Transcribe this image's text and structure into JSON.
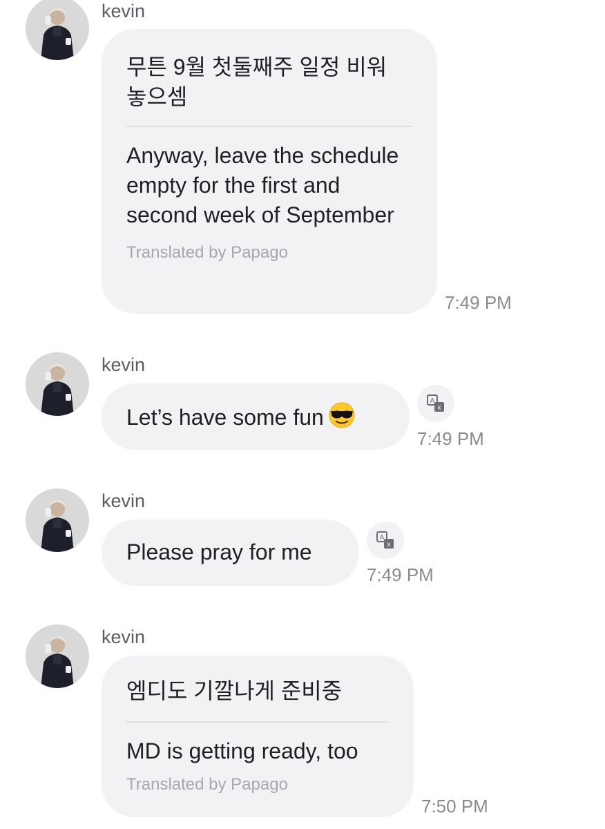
{
  "messages": [
    {
      "sender": "kevin",
      "original": "무튼 9월 첫둘째주 일정 비워 놓으셈",
      "translated": "Anyway, leave the schedule empty for the first and second week of September",
      "credit": "Translated by Papago",
      "time": "7:49 PM"
    },
    {
      "sender": "kevin",
      "text": "Let’s have some fun",
      "emoji": "smiling-face-with-sunglasses",
      "time": "7:49 PM"
    },
    {
      "sender": "kevin",
      "text": "Please pray for me",
      "time": "7:49 PM"
    },
    {
      "sender": "kevin",
      "original": "엠디도 기깔나게 준비중",
      "translated": "MD is getting ready, too",
      "credit": "Translated by Papago",
      "time": "7:50 PM"
    }
  ],
  "colors": {
    "bubble": "#f2f2f5",
    "text": "#1f1f24",
    "sender": "#5c5c64",
    "timestamp": "#8a8a92",
    "credit": "#a7a7af"
  }
}
